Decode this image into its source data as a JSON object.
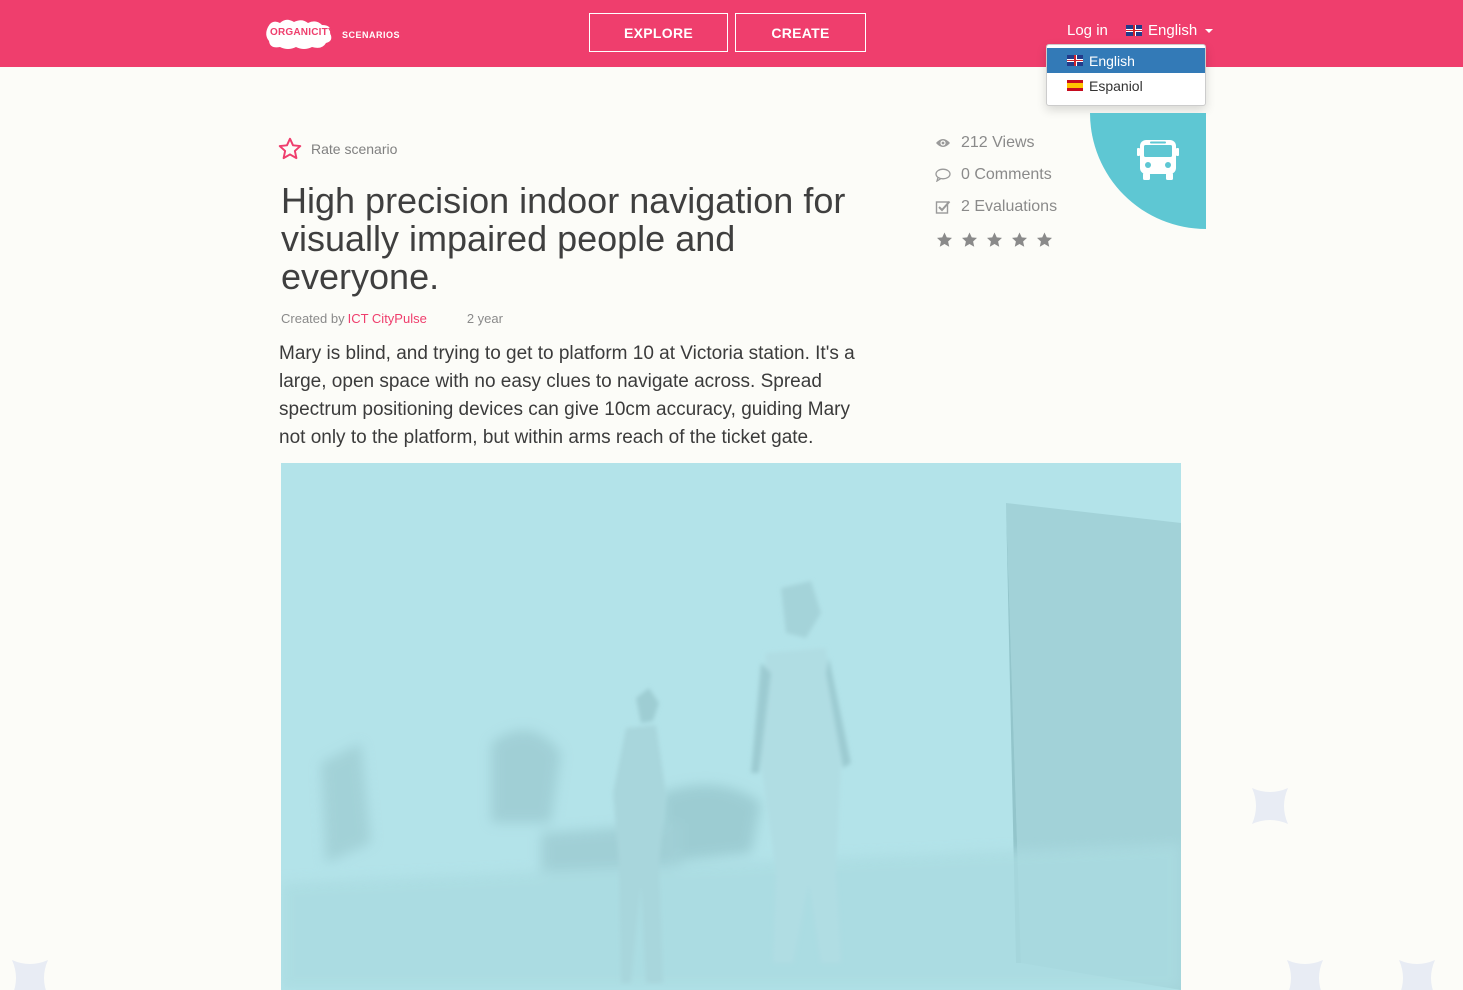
{
  "header": {
    "logo_text": "ORGANICITY",
    "logo_sub": "SCENARIOS",
    "nav": {
      "explore_label": "EXPLORE",
      "create_label": "CREATE"
    },
    "login_label": "Log in",
    "language": {
      "selected": "English",
      "options": [
        {
          "label": "English",
          "flag": "uk-flag-icon",
          "active": true
        },
        {
          "label": "Espaniol",
          "flag": "spain-flag-icon",
          "active": false
        }
      ]
    },
    "accent_color": "#ef3e6d"
  },
  "scenario": {
    "rate_label": "Rate scenario",
    "title": "High precision indoor navigation for visually impaired people and everyone.",
    "created_by_label": "Created by",
    "author": "ICT CityPulse",
    "age": "2 year",
    "description": "Mary is blind, and trying to get to platform 10 at Victoria station. It's a large, open space with no easy clues to navigate across. Spread spectrum positioning devices can give 10cm accuracy, guiding Mary not only to the platform, but within arms reach of the ticket gate.",
    "stats": {
      "views": "212 Views",
      "comments": "0 Comments",
      "evaluations": "2 Evaluations"
    },
    "rating": {
      "stars_filled": 0,
      "stars_total": 5
    },
    "category_icon": "bus-icon",
    "category_color": "#5ec7d3"
  }
}
